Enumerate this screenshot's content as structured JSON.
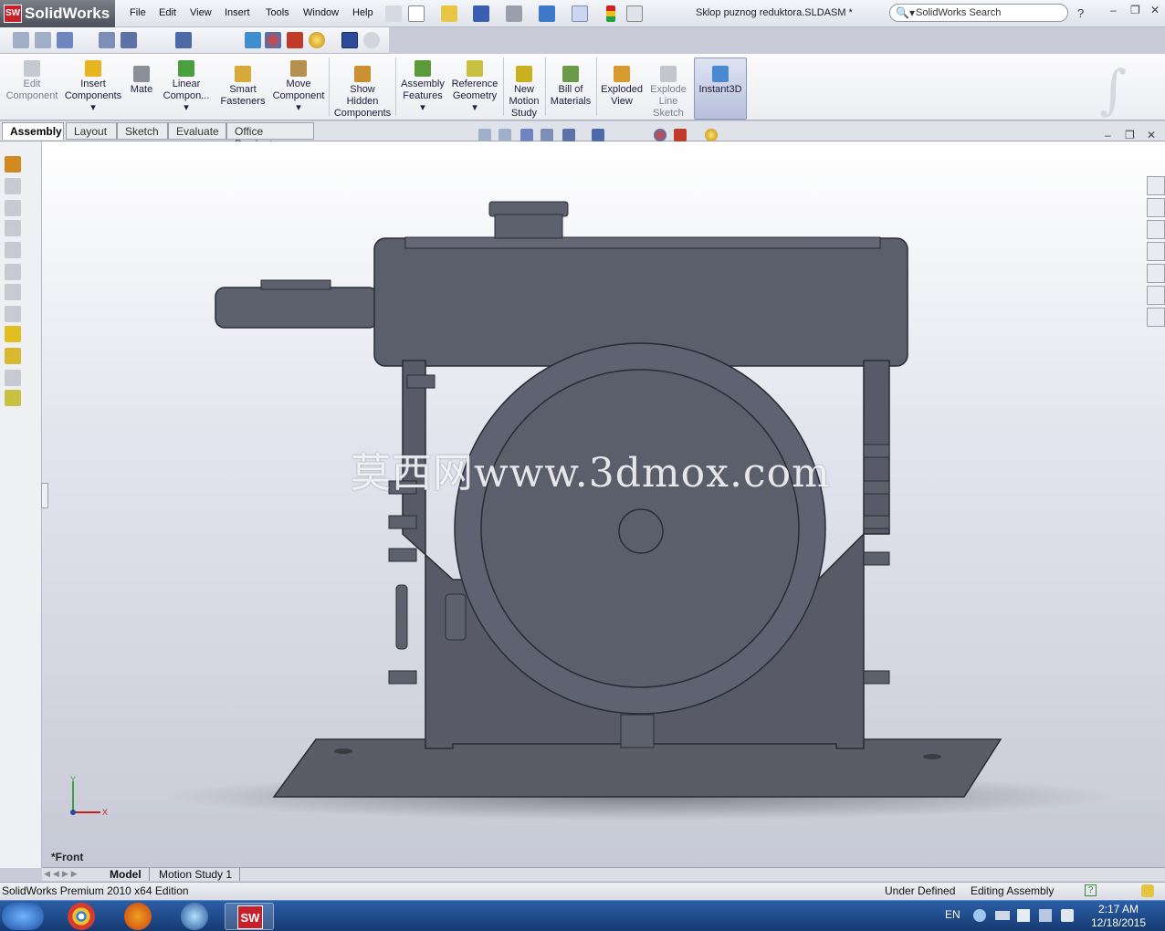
{
  "app": {
    "brand": "SolidWorks",
    "brand_badge": "SW",
    "document_title": "Sklop puznog reduktora.SLDASM *",
    "search_placeholder": "SolidWorks Search",
    "help": "?"
  },
  "menu": [
    "File",
    "Edit",
    "View",
    "Insert",
    "Tools",
    "Window",
    "Help"
  ],
  "command_manager": [
    {
      "label_lines": [
        "Edit",
        "Component"
      ],
      "enabled": false
    },
    {
      "label_lines": [
        "Insert",
        "Components"
      ],
      "enabled": true
    },
    {
      "label_lines": [
        "Mate"
      ],
      "enabled": true
    },
    {
      "label_lines": [
        "Linear",
        "Compon..."
      ],
      "enabled": true
    },
    {
      "label_lines": [
        "Smart",
        "Fasteners"
      ],
      "enabled": true
    },
    {
      "label_lines": [
        "Move",
        "Component"
      ],
      "enabled": true
    },
    {
      "label_lines": [
        "Show",
        "Hidden",
        "Components"
      ],
      "enabled": true
    },
    {
      "label_lines": [
        "Assembly",
        "Features"
      ],
      "enabled": true
    },
    {
      "label_lines": [
        "Reference",
        "Geometry"
      ],
      "enabled": true
    },
    {
      "label_lines": [
        "New",
        "Motion",
        "Study"
      ],
      "enabled": true
    },
    {
      "label_lines": [
        "Bill of",
        "Materials"
      ],
      "enabled": true
    },
    {
      "label_lines": [
        "Exploded",
        "View"
      ],
      "enabled": true
    },
    {
      "label_lines": [
        "Explode",
        "Line",
        "Sketch"
      ],
      "enabled": false
    },
    {
      "label_lines": [
        "Instant3D"
      ],
      "enabled": true
    }
  ],
  "tabs": [
    "Assembly",
    "Layout",
    "Sketch",
    "Evaluate",
    "Office Products"
  ],
  "active_tab": "Assembly",
  "viewport": {
    "watermark": "莫西网www.3dmox.com",
    "view_orientation": "*Front",
    "axis_x": "X",
    "axis_y": "Y"
  },
  "bottom_tabs": [
    "Model",
    "Motion Study 1"
  ],
  "status": {
    "edition": "SolidWorks Premium 2010 x64 Edition",
    "definition": "Under Defined",
    "mode": "Editing Assembly"
  },
  "taskbar": {
    "language": "EN",
    "time": "2:17 AM",
    "date": "12/18/2015",
    "sw_label": "SW"
  },
  "colors": {
    "model": "#5b5e6b",
    "model_edge": "#2b2d35",
    "viewport_top": "#ffffff",
    "viewport_bottom": "#c7cad6",
    "taskbar": "#1f4a8a",
    "brand_red": "#c8202a"
  }
}
